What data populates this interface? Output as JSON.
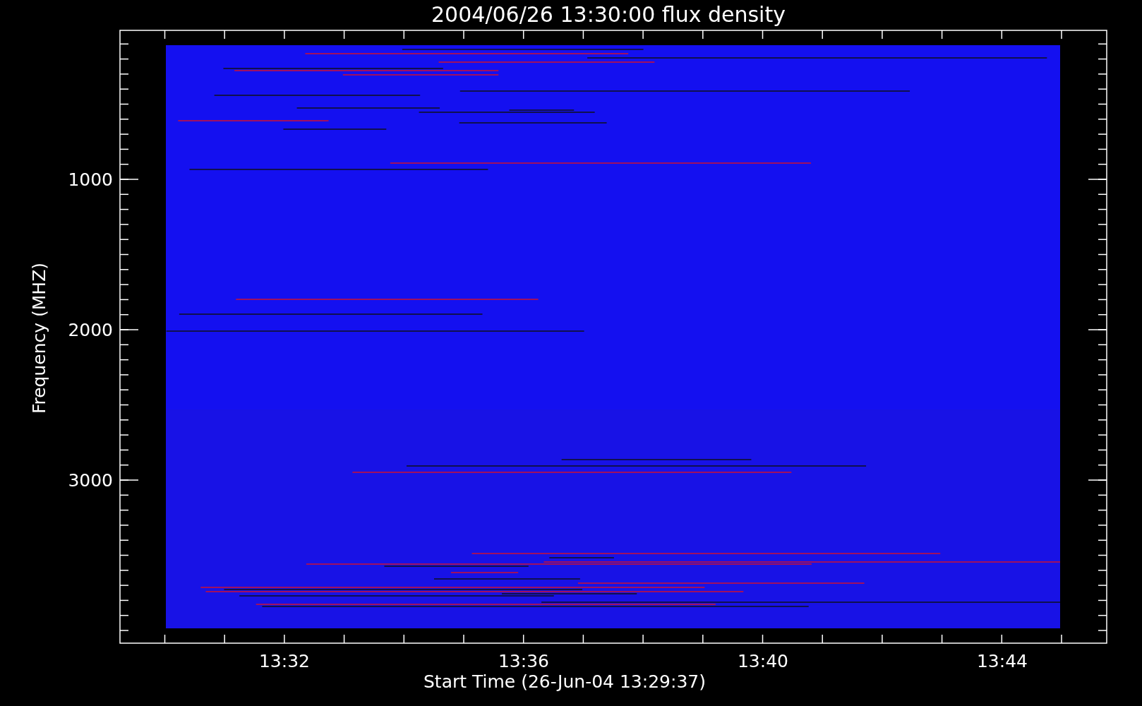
{
  "title": "2004/06/26 13:30:00 flux density",
  "y_axis": {
    "label": "Frequency (MHZ)",
    "tick_labels": [
      "1000",
      "2000",
      "3000"
    ]
  },
  "x_axis": {
    "label": "Start Time (26-Jun-04 13:29:37)",
    "tick_labels": [
      "13:32",
      "13:36",
      "13:40",
      "13:44"
    ]
  }
}
